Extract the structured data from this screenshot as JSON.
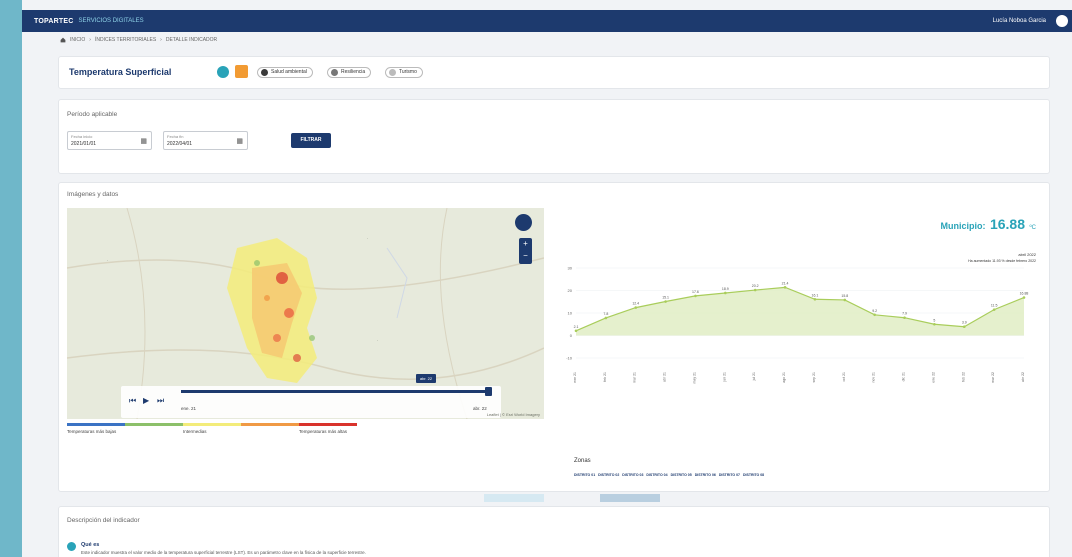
{
  "header": {
    "logo": "TOPARTEC",
    "subtitle": "SERVICIOS DIGITALES",
    "user": "Lucía Noboa Garcia"
  },
  "breadcrumb": {
    "home": "INICIO",
    "sep": "›",
    "level1": "ÍNDICES TERRITORIALES",
    "level2": "DETALLE INDICADOR"
  },
  "indicator": {
    "title": "Temperatura Superficial",
    "tags": [
      "Salud ambiental",
      "Resiliencia",
      "Turismo"
    ]
  },
  "period": {
    "title": "Período aplicable",
    "start_label": "Fecha inicio",
    "start_value": "2021/01/01",
    "end_label": "Fecha fin",
    "end_value": "2022/04/01",
    "filter_label": "FILTRAR"
  },
  "images": {
    "title": "Imágenes y datos",
    "player_start": "ene. 21",
    "player_end": "abr. 22",
    "player_current": "abr. 22",
    "legend": [
      "Temperaturas más bajas",
      "Intermedias",
      "Temperaturas más altas"
    ],
    "legend_colors": [
      "#3b73c4",
      "#8cc06a",
      "#f3ec7a",
      "#f09a45",
      "#d9332c"
    ],
    "map_credit": "Leaflet | © Esri World Imagery"
  },
  "municipio": {
    "label": "Municipio:",
    "value": "16.88",
    "unit": "ºC",
    "date": "abril 2022",
    "note": "Ha aumentado 11.93 % desde febrero 2022"
  },
  "chart_data": {
    "type": "area",
    "x": [
      "ene 21",
      "feb 21",
      "mar 21",
      "abr 21",
      "may 21",
      "jun 21",
      "jul 21",
      "ago 21",
      "sep 21",
      "oct 21",
      "nov 21",
      "dic 21",
      "ene 22",
      "feb 22",
      "mar 22",
      "abr 22"
    ],
    "values": [
      2.1,
      7.8,
      12.4,
      15.1,
      17.6,
      18.9,
      20.2,
      21.4,
      16.1,
      15.8,
      9.2,
      7.9,
      5.0,
      3.9,
      11.5,
      16.88
    ],
    "ylim": [
      -10,
      30
    ],
    "yticks": [
      30,
      20,
      10,
      0,
      -10
    ],
    "color": "#a9cd5b"
  },
  "zonas": {
    "title": "Zonas",
    "items": [
      "DISTRITO 01",
      "DISTRITO 02",
      "DISTRITO 03",
      "DISTRITO 04",
      "DISTRITO 05",
      "DISTRITO 06",
      "DISTRITO 07",
      "DISTRITO 08"
    ]
  },
  "description": {
    "title": "Descripción del indicador",
    "question": "Qué es",
    "text": "Este indicador muestra el valor medio de la temperatura superficial terrestre (LST). Es un parámetro clave en la física de la superficie terrestre."
  }
}
